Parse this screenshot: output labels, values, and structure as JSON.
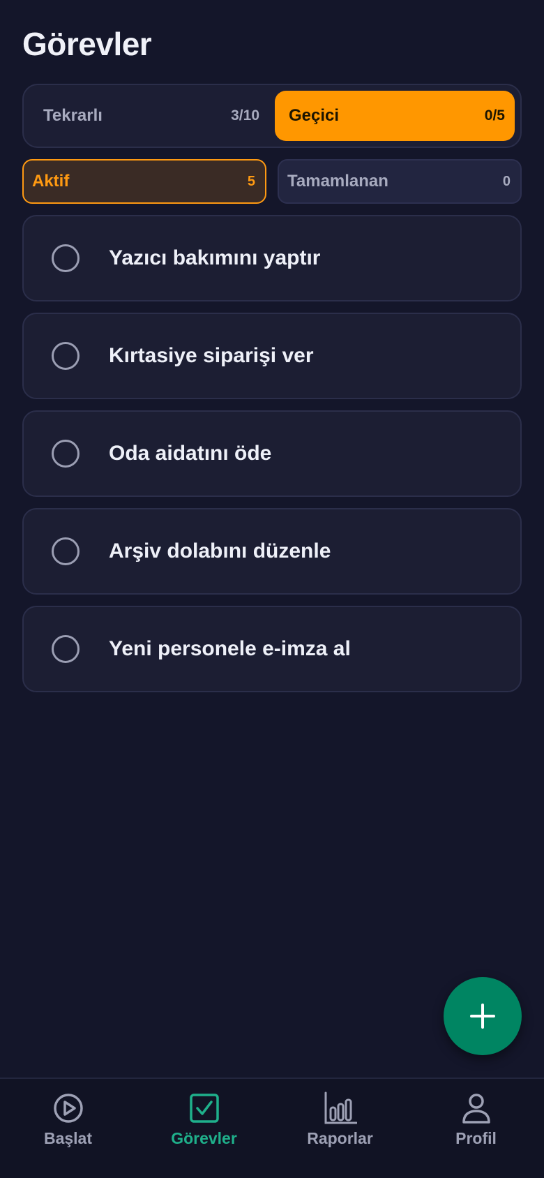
{
  "header": {
    "title": "Görevler"
  },
  "segment": {
    "recurring": {
      "label": "Tekrarlı",
      "count": "3/10"
    },
    "temporary": {
      "label": "Geçici",
      "count": "0/5"
    }
  },
  "filters": {
    "active": {
      "label": "Aktif",
      "count": "5"
    },
    "completed": {
      "label": "Tamamlanan",
      "count": "0"
    }
  },
  "tasks": [
    {
      "title": "Yazıcı bakımını yaptır"
    },
    {
      "title": "Kırtasiye siparişi ver"
    },
    {
      "title": "Oda aidatını öde"
    },
    {
      "title": "Arşiv dolabını düzenle"
    },
    {
      "title": "Yeni personele e-imza al"
    }
  ],
  "fab": {
    "icon": "plus-icon"
  },
  "tabbar": {
    "items": [
      {
        "label": "Başlat",
        "icon": "play-circle-icon"
      },
      {
        "label": "Görevler",
        "icon": "checkbox-icon"
      },
      {
        "label": "Raporlar",
        "icon": "bar-chart-icon"
      },
      {
        "label": "Profil",
        "icon": "person-icon"
      }
    ]
  },
  "colors": {
    "background": "#14162a",
    "accent": "#ff9700",
    "primary_green": "#008562",
    "tab_active": "#1fb08b"
  }
}
